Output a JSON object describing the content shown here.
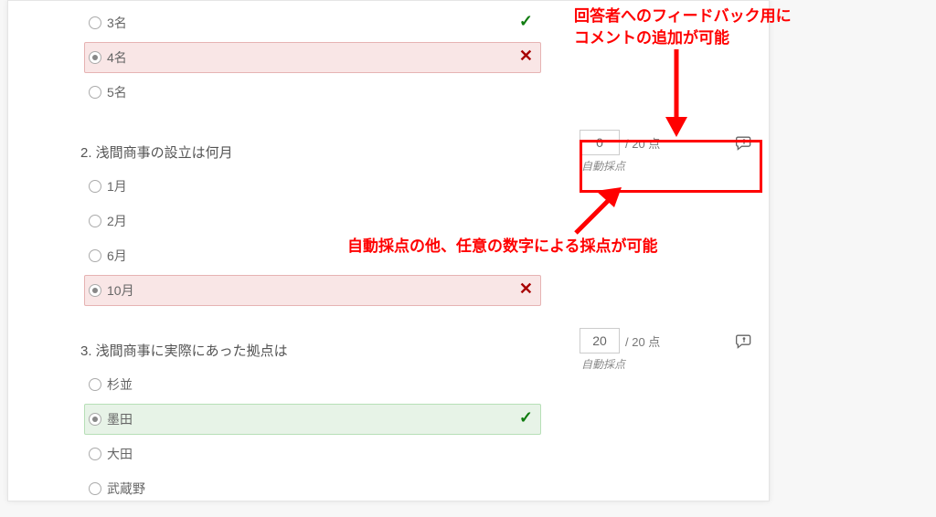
{
  "q1": {
    "options": [
      "3名",
      "4名",
      "5名"
    ]
  },
  "q2": {
    "title": "2. 浅間商事の設立は何月",
    "options": [
      "1月",
      "2月",
      "6月",
      "10月"
    ],
    "score_value": "0",
    "score_max": "/ 20 点",
    "auto": "自動採点"
  },
  "q3": {
    "title": "3. 浅間商事に実際にあった拠点は",
    "options": [
      "杉並",
      "墨田",
      "大田",
      "武蔵野"
    ],
    "score_value": "20",
    "score_max": "/ 20 点",
    "auto": "自動採点"
  },
  "anno1": "回答者へのフィードバック用に\nコメントの追加が可能",
  "anno2": "自動採点の他、任意の数字による採点が可能"
}
